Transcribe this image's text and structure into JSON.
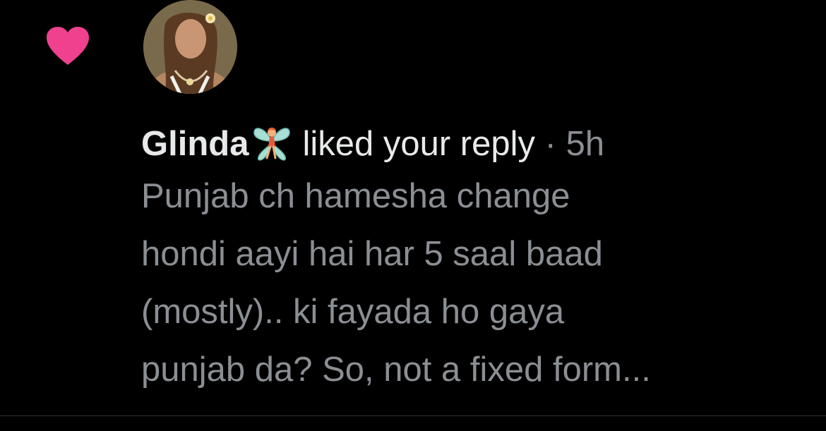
{
  "notification": {
    "type_icon": "heart-icon",
    "type_color": "#f0418f",
    "avatar_icon": "avatar-icon",
    "user_name": "Glinda",
    "user_emoji": "fairy-icon",
    "action_text": "liked your reply",
    "separator": "·",
    "timestamp": "5h",
    "reply_lines": [
      "Punjab ch hamesha change",
      "hondi aayi hai har 5 saal baad",
      "(mostly).. ki fayada ho gaya",
      "punjab da? So, not a fixed form..."
    ]
  },
  "colors": {
    "background": "#000000",
    "primary_text": "#e7e9ea",
    "secondary_text": "#8b8f94",
    "like_pink": "#f0418f",
    "divider": "#2f3336"
  }
}
